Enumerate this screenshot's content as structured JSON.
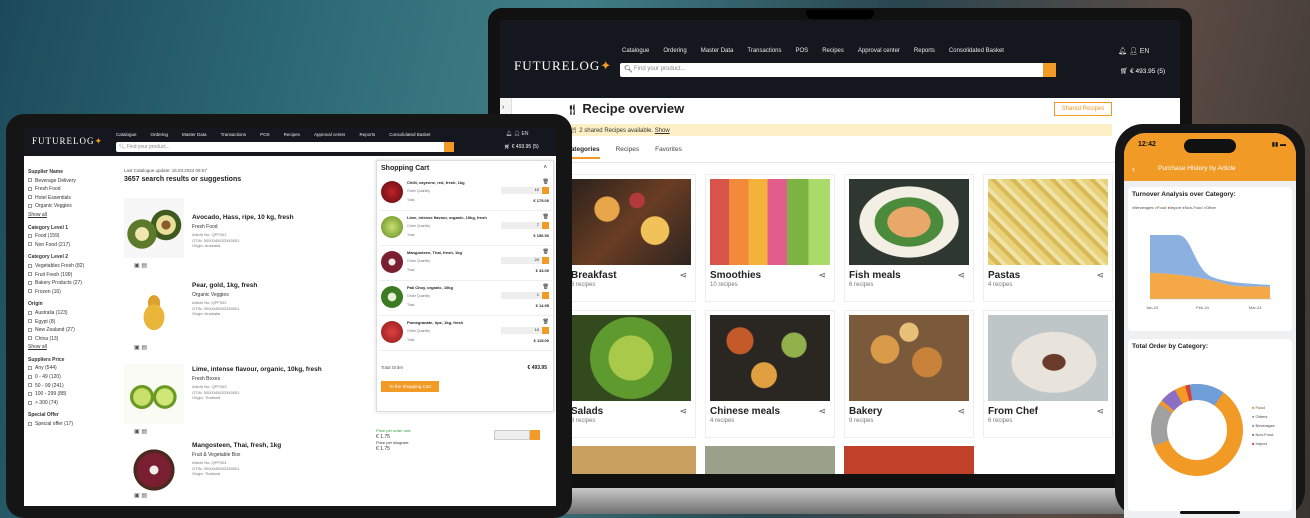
{
  "laptop": {
    "logo": "FUTURELOG",
    "menu": [
      "Catalogue",
      "Ordering",
      "Master Data",
      "Transactions",
      "POS",
      "Recipes",
      "Approval center",
      "Reports",
      "Consolidated Basket"
    ],
    "lang": "EN",
    "search_placeholder": "Find your product...",
    "basket": "€ 493.95 (5)",
    "page_title": "Recipe overview",
    "shared_btn": "Shared Recipes",
    "banner_text": "2 shared Recipes available.",
    "banner_link": "Show",
    "tabs": [
      "Categories",
      "Recipes",
      "Favorites"
    ],
    "categories": [
      {
        "name": "Breakfast",
        "count": "6 recipes"
      },
      {
        "name": "Smoothies",
        "count": "10 recipes"
      },
      {
        "name": "Fish meals",
        "count": "6 recipes"
      },
      {
        "name": "Pastas",
        "count": "4 recipes"
      },
      {
        "name": "Salads",
        "count": "8 recipes"
      },
      {
        "name": "Chinese meals",
        "count": "4 recipes"
      },
      {
        "name": "Bakery",
        "count": "9 recipes"
      },
      {
        "name": "From Chef",
        "count": "6 recipes"
      }
    ]
  },
  "tablet": {
    "logo": "FUTURELOG",
    "menu": [
      "Catalogue",
      "Ordering",
      "Master Data",
      "Transactions",
      "POS",
      "Recipes",
      "Approval center",
      "Reports",
      "Consolidated Basket"
    ],
    "lang": "EN",
    "search_placeholder": "Find your product...",
    "basket": "€ 493.95 (5)",
    "last_update": "Last Catalogue update: 15.03.2024 09:57",
    "results": "3657 search results or suggestions",
    "filters": [
      {
        "title": "Supplier Name",
        "items": [
          "Beverage Delivery",
          "Fresh Food",
          "Hotel Essentials",
          "Organic Veggies"
        ],
        "show_all": "Show all"
      },
      {
        "title": "Category Level 1",
        "items": [
          "Food (159)",
          "Non Food (217)"
        ]
      },
      {
        "title": "Category Level 2",
        "items": [
          "Vegetables Fresh (82)",
          "Fruit Fresh (199)",
          "Bakery Products (27)",
          "Frozen (16)"
        ]
      },
      {
        "title": "Origin",
        "items": [
          "Australia (123)",
          "Egypt (8)",
          "New Zealand (27)",
          "China (13)"
        ],
        "show_all": "Show all"
      },
      {
        "title": "Suppliers Price",
        "items": [
          "Any (544)",
          "0 - 49 (120)",
          "50 - 99 (241)",
          "100 - 299 (88)",
          "> 300 (74)"
        ]
      },
      {
        "title": "Special Offer",
        "items": [
          "Special offer (17)"
        ]
      }
    ],
    "products": [
      {
        "name": "Avocado, Hass, ripe, 10 kg, fresh",
        "supplier": "Fresh Food",
        "article": "Article No: QPF001",
        "gtin": "GTIN: 0000345532345001",
        "origin": "Origin: Australia"
      },
      {
        "name": "Pear, gold, 1kg, fresh",
        "supplier": "Organic Veggies",
        "article": "Article No: QPF002",
        "gtin": "GTIN: 0000345532345001",
        "origin": "Origin: Australia"
      },
      {
        "name": "Lime, intense flavour, organic, 10kg, fresh",
        "supplier": "Fresh Boxes",
        "article": "Article No: QPF003",
        "gtin": "GTIN: 0000345532345001",
        "origin": "Origin: Thailand"
      },
      {
        "name": "Mangosteen, Thai, fresh, 1kg",
        "supplier": "Fruit & Vegetable Box",
        "article": "Article No: QPF004",
        "gtin": "GTIN: 0000345532345001",
        "origin": "Origin: Thailand"
      }
    ],
    "cart": {
      "title": "Shopping Cart",
      "items": [
        {
          "name": "Chilli, cayenne, red, fresh, 1kg",
          "qty": "10",
          "total": "€ 175.00"
        },
        {
          "name": "Lime, intense flavour, organic, 10kg, fresh",
          "qty": "7",
          "total": "€ 156.50"
        },
        {
          "name": "Mangosteen, Thai, fresh, 1kg",
          "qty": "20",
          "total": "€ 33.00"
        },
        {
          "name": "Pak Choy, organic, 10kg",
          "qty": "1",
          "total": "€ 14.95"
        },
        {
          "name": "Pomegranate, ripe, 1kg, fresh",
          "qty": "10",
          "total": "€ 115.00"
        }
      ],
      "order_qty_label": "Order Quantity",
      "total_label": "Total",
      "total_order_label": "Total Order",
      "total_order": "€ 493.95",
      "button": "To the Shopping Cart"
    },
    "price_block": {
      "line1": "Price per order unit:",
      "price1": "€ 1.75",
      "line2": "Price per kilogram:",
      "price2": "€ 1.75"
    }
  },
  "phone": {
    "time": "12:42",
    "header": "Purchase History by Article",
    "turnover_title": "Turnover Analysis over Category:",
    "legend": [
      "Beverages",
      "Food",
      "Import",
      "Non-Food",
      "Other"
    ],
    "months": [
      "Jan-24",
      "Feb-24",
      "Mar-24"
    ],
    "order_title": "Total Order by Category:",
    "donut_legend": [
      "Food",
      "Others",
      "Beverages",
      "Non-Food",
      "Import"
    ],
    "colors": {
      "food": "#f29a26",
      "beverages": "#6f9ed8",
      "import": "#d6403b",
      "nonfood": "#8b6fc7",
      "other": "#a0a0a0"
    }
  },
  "accent": "#f29a26"
}
